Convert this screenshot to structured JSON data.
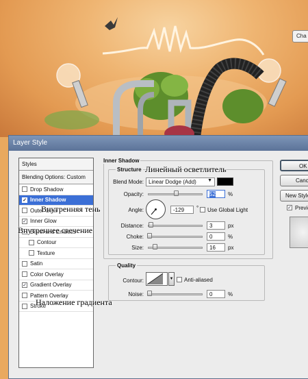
{
  "background": {
    "partial_button_label": "Cha"
  },
  "dialog": {
    "title": "Layer Style",
    "styles_list": [
      {
        "label": "Styles",
        "kind": "header"
      },
      {
        "label": "Blending Options: Custom",
        "kind": "blend"
      },
      {
        "label": "Drop Shadow",
        "checked": false
      },
      {
        "label": "Inner Shadow",
        "checked": true,
        "selected": true
      },
      {
        "label": "Outer Glow",
        "checked": false
      },
      {
        "label": "Inner Glow",
        "checked": true
      },
      {
        "label": "Bevel and Emboss",
        "checked": false
      },
      {
        "label": "Contour",
        "checked": false,
        "indent": true
      },
      {
        "label": "Texture",
        "checked": false,
        "indent": true
      },
      {
        "label": "Satin",
        "checked": false
      },
      {
        "label": "Color Overlay",
        "checked": false
      },
      {
        "label": "Gradient Overlay",
        "checked": true
      },
      {
        "label": "Pattern Overlay",
        "checked": false
      },
      {
        "label": "Stroke",
        "checked": false
      }
    ],
    "inner_shadow": {
      "section_title": "Inner Shadow",
      "structure_title": "Structure",
      "blend_mode_label": "Blend Mode:",
      "blend_mode_value": "Linear Dodge (Add)",
      "blend_color": "#000000",
      "opacity_label": "Opacity:",
      "opacity_value": "52",
      "opacity_unit": "%",
      "opacity_fraction": 0.52,
      "angle_label": "Angle:",
      "angle_value": "-129",
      "angle_unit": "°",
      "use_global_light_label": "Use Global Light",
      "use_global_light_checked": false,
      "distance_label": "Distance:",
      "distance_value": "3",
      "distance_unit": "px",
      "choke_label": "Choke:",
      "choke_value": "0",
      "choke_unit": "%",
      "size_label": "Size:",
      "size_value": "16",
      "size_unit": "px"
    },
    "quality": {
      "title": "Quality",
      "contour_label": "Contour:",
      "anti_aliased_label": "Anti-aliased",
      "anti_aliased_checked": false,
      "noise_label": "Noise:",
      "noise_value": "0",
      "noise_unit": "%"
    },
    "buttons": {
      "ok": "OK",
      "cancel": "Cancel",
      "new_style": "New Style...",
      "preview_label": "Preview",
      "preview_checked": true
    }
  },
  "annotations": {
    "blend_mode_note": "Линейный осветлитель",
    "inner_shadow_note": "Внутренняя тень",
    "inner_glow_note": "Внутреннее свечение",
    "gradient_overlay_note": "Наложение градиента"
  }
}
